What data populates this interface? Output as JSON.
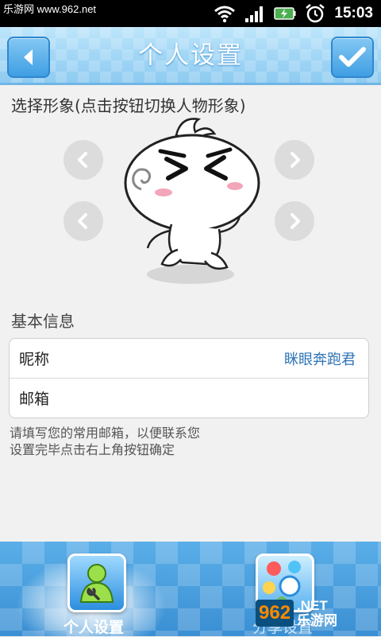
{
  "status_bar": {
    "watermark": "乐游网 www.962.net",
    "time": "15:03"
  },
  "header": {
    "title": "个人设置"
  },
  "avatar_section": {
    "label": "选择形象(点击按钮切换人物形象)"
  },
  "basic_info": {
    "label": "基本信息",
    "fields": [
      {
        "label": "昵称",
        "value": "眯眼奔跑君"
      },
      {
        "label": "邮箱",
        "value": ""
      }
    ],
    "hint_line1": "请填写您的常用邮箱，以便联系您",
    "hint_line2": "设置完毕点击右上角按钮确定"
  },
  "tabs": [
    {
      "label": "个人设置",
      "icon": "user-settings-icon",
      "active": true
    },
    {
      "label": "分享设置",
      "icon": "share-icon",
      "active": false
    }
  ],
  "watermark_br": {
    "number": "962",
    "site": ".NET",
    "cn": "乐游网"
  },
  "colors": {
    "accent": "#3a8fd3",
    "title_bar": "#a5d8f6",
    "nickname_value": "#2f74b8"
  }
}
